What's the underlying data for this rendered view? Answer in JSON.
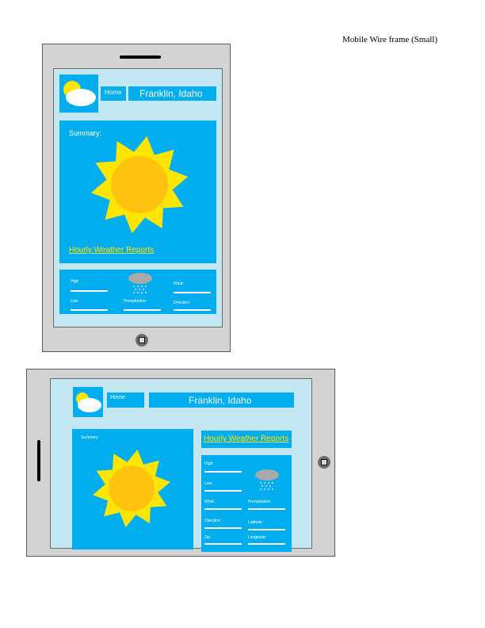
{
  "page": {
    "title": "Mobile Wire frame (Small)"
  },
  "portrait": {
    "nav": {
      "home": "Home",
      "location": "Franklin, Idaho"
    },
    "summary": {
      "label": "Summary:",
      "link": "Hourly Weather Reports"
    },
    "details": {
      "high": "High",
      "wind": "Wind:",
      "low": "Low:",
      "precipitation": "Precipitation:",
      "direction": "Direction:"
    }
  },
  "landscape": {
    "nav": {
      "home": "Home",
      "location": "Franklin, Idaho"
    },
    "summary": {
      "label": "Summary:"
    },
    "link": "Hourly Weather Reports",
    "details": {
      "high": "High:",
      "low": "Low:",
      "wind": "Wind:",
      "precipitation": "Precipitation:",
      "direction": "Direction:",
      "latitude": "Latitude:",
      "zip": "Zip:",
      "longitude": "Longitude:"
    }
  },
  "colors": {
    "device": "#d3d3d3",
    "screen": "#c3e6f3",
    "panel": "#00adef",
    "link": "#ffe600",
    "sun_outer": "#ffe600",
    "sun_inner": "#ffc20e",
    "cloud": "#a9a9a9",
    "rain": "#8fd3f4"
  },
  "icons": [
    "weather-logo-icon",
    "sun-icon",
    "rain-cloud-icon",
    "home-button-icon",
    "speaker-icon"
  ]
}
